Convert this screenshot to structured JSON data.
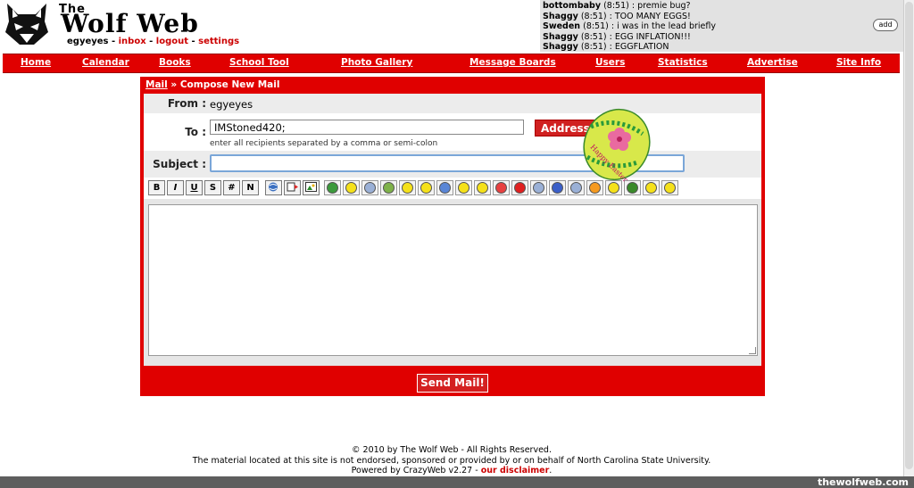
{
  "brand": {
    "the": "The",
    "name": "Wolf Web"
  },
  "user": {
    "name": "egyeyes",
    "links": [
      "inbox",
      "logout",
      "settings"
    ],
    "sep": " - "
  },
  "shoutbox": {
    "messages": [
      {
        "user": "bottombaby",
        "time": "(8:51)",
        "text": ": premie bug?"
      },
      {
        "user": "Shaggy",
        "time": "(8:51)",
        "text": ": TOO MANY EGGS!"
      },
      {
        "user": "Sweden",
        "time": "(8:51)",
        "text": ": i was in the lead briefly"
      },
      {
        "user": "Shaggy",
        "time": "(8:51)",
        "text": ": EGG INFLATION!!!"
      },
      {
        "user": "Shaggy",
        "time": "(8:51)",
        "text": ": EGGFLATION"
      }
    ],
    "add_label": "add"
  },
  "nav": [
    "Home",
    "Calendar",
    "Books",
    "School Tool",
    "Photo Gallery",
    "Message Boards",
    "Users",
    "Statistics",
    "Advertise",
    "Site Info"
  ],
  "compose": {
    "crumb_mail": "Mail",
    "crumb_sep": " » ",
    "crumb_page": "Compose New Mail",
    "from_label": "From :",
    "from_value": "egyeyes",
    "to_label": "To :",
    "to_value": "IMStoned420;",
    "to_hint": "enter all recipients separated by a comma or semi-colon",
    "address_label": "Address Book",
    "subject_label": "Subject :",
    "subject_value": "",
    "format_buttons": [
      "B",
      "I",
      "U",
      "S",
      "#",
      "N"
    ],
    "insert_icons": [
      "link-icon",
      "video-icon",
      "image-icon"
    ],
    "smiley_colors": [
      "#3c9a3c",
      "#f5e11a",
      "#9ab0d6",
      "#7fb24a",
      "#f5e11a",
      "#f5e11a",
      "#5a86d6",
      "#f5e11a",
      "#f5e11a",
      "#e84040",
      "#e02020",
      "#9ab0d6",
      "#3a5fc8",
      "#9ab0d6",
      "#f59a20",
      "#f5e11a",
      "#3a8a2a",
      "#f5e11a",
      "#f5e11a"
    ],
    "send_label": "Send Mail!"
  },
  "easter_egg": {
    "text": "Happy Easter"
  },
  "footer": {
    "line1": "© 2010 by The Wolf Web - All Rights Reserved.",
    "line2": "The material located at this site is not endorsed, sponsored or provided by or on behalf of North Carolina State University.",
    "line3_prefix": "Powered by CrazyWeb v2.27 - ",
    "line3_link": "our disclaimer",
    "line3_suffix": "."
  },
  "watermark": "thewolfweb.com",
  "colors": {
    "accent": "#e00000",
    "link": "#cc0000",
    "panel_bg": "#e6e6e6"
  }
}
